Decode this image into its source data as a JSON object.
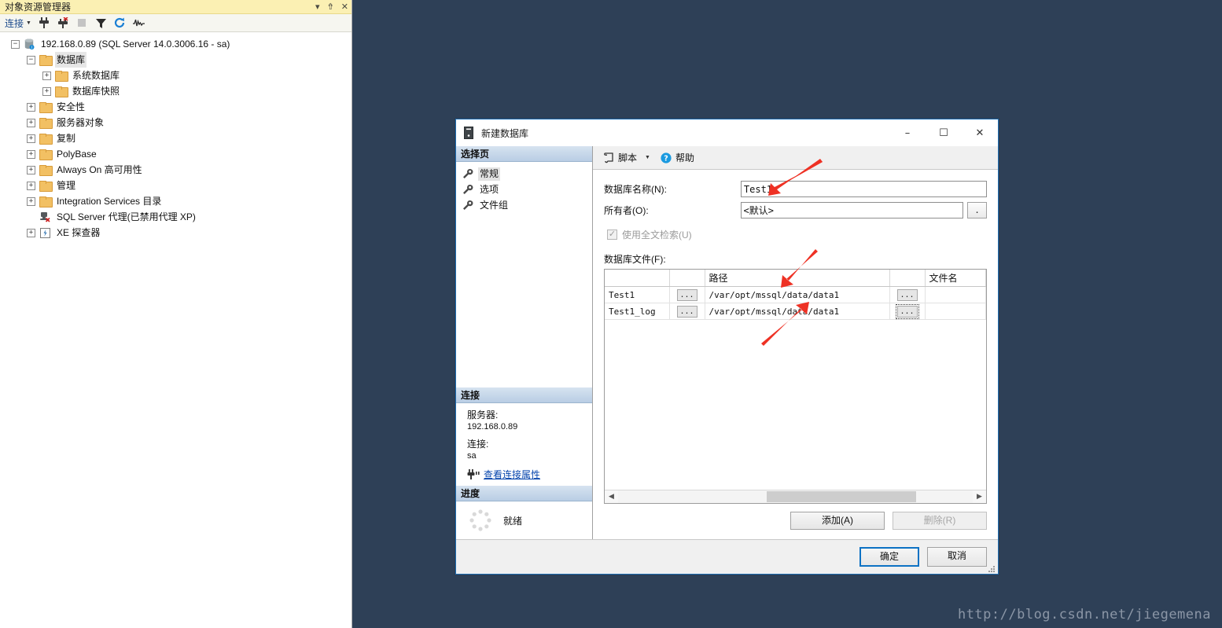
{
  "object_explorer": {
    "title": "对象资源管理器",
    "title_buttons": [
      {
        "name": "dropdown-icon",
        "glyph": "▾"
      },
      {
        "name": "pin-icon",
        "glyph": "⇮"
      },
      {
        "name": "close-icon",
        "glyph": "✕"
      }
    ],
    "toolbar": {
      "connect_label": "连接",
      "icons": [
        "connect-icon",
        "disconnect-icon",
        "stop-icon",
        "filter-icon",
        "refresh-icon",
        "activity-monitor-icon"
      ]
    },
    "tree": [
      {
        "label": "192.168.0.89 (SQL Server 14.0.3006.16 - sa)",
        "indent": 0,
        "state": "expanded",
        "icon": "server-icon",
        "selected": false
      },
      {
        "label": "数据库",
        "indent": 1,
        "state": "expanded",
        "icon": "folder-icon",
        "selected": true
      },
      {
        "label": "系统数据库",
        "indent": 2,
        "state": "collapsed",
        "icon": "folder-icon",
        "selected": false
      },
      {
        "label": "数据库快照",
        "indent": 2,
        "state": "collapsed",
        "icon": "folder-icon",
        "selected": false
      },
      {
        "label": "安全性",
        "indent": 1,
        "state": "collapsed",
        "icon": "folder-icon",
        "selected": false
      },
      {
        "label": "服务器对象",
        "indent": 1,
        "state": "collapsed",
        "icon": "folder-icon",
        "selected": false
      },
      {
        "label": "复制",
        "indent": 1,
        "state": "collapsed",
        "icon": "folder-icon",
        "selected": false
      },
      {
        "label": "PolyBase",
        "indent": 1,
        "state": "collapsed",
        "icon": "folder-icon",
        "selected": false
      },
      {
        "label": "Always On 高可用性",
        "indent": 1,
        "state": "collapsed",
        "icon": "folder-icon",
        "selected": false
      },
      {
        "label": "管理",
        "indent": 1,
        "state": "collapsed",
        "icon": "folder-icon",
        "selected": false
      },
      {
        "label": "Integration Services 目录",
        "indent": 1,
        "state": "collapsed",
        "icon": "folder-icon",
        "selected": false
      },
      {
        "label": "SQL Server 代理(已禁用代理 XP)",
        "indent": 1,
        "state": "leaf",
        "icon": "agent-disabled-icon",
        "selected": false
      },
      {
        "label": "XE 探查器",
        "indent": 1,
        "state": "collapsed",
        "icon": "xe-profiler-icon",
        "selected": false
      }
    ]
  },
  "dialog": {
    "title": "新建数据库",
    "window_buttons": {
      "minimize": "–",
      "maximize": "☐",
      "close": "✕"
    },
    "select_page": {
      "header": "选择页",
      "items": [
        {
          "label": "常规",
          "active": true
        },
        {
          "label": "选项",
          "active": false
        },
        {
          "label": "文件组",
          "active": false
        }
      ]
    },
    "script_bar": {
      "script_label": "脚本",
      "caret": "▾",
      "help_label": "帮助"
    },
    "general": {
      "db_name_label": "数据库名称(N):",
      "db_name_value": "Test1",
      "owner_label": "所有者(O):",
      "owner_value": "<默认>",
      "owner_browse_label": ".",
      "fulltext_label": "使用全文检索(U)",
      "fulltext_checked": true,
      "fulltext_enabled": false,
      "files_label": "数据库文件(F):",
      "grid": {
        "columns": [
          "",
          "",
          "路径",
          "",
          "文件名"
        ],
        "rows": [
          {
            "logical_name": "Test1",
            "browse1": "...",
            "path": "/var/opt/mssql/data/data1",
            "browse2": "...",
            "file_name": "",
            "focused_cell": false
          },
          {
            "logical_name": "Test1_log",
            "browse1": "...",
            "path": "/var/opt/mssql/data/data1",
            "browse2": "...",
            "file_name": "",
            "focused_cell": true
          }
        ]
      },
      "add_label": "添加(A)",
      "remove_label": "删除(R)",
      "remove_enabled": false
    },
    "connection": {
      "header": "连接",
      "server_label": "服务器:",
      "server_value": "192.168.0.89",
      "connection_label": "连接:",
      "connection_value": "sa",
      "view_props_link": "查看连接属性"
    },
    "progress": {
      "header": "进度",
      "status": "就绪"
    },
    "footer": {
      "ok_label": "确定",
      "cancel_label": "取消"
    }
  },
  "watermark": "http://blog.csdn.net/jiegemena",
  "colors": {
    "desktop_bg": "#2e4057",
    "explorer_titlebar": "#fbf0b3",
    "dialog_border": "#1f6fb5",
    "panel_header_gradient_top": "#d6e3f0",
    "link": "#0645ad",
    "annotation_arrow": "#ee3124",
    "default_button_border": "#0d72c4"
  }
}
